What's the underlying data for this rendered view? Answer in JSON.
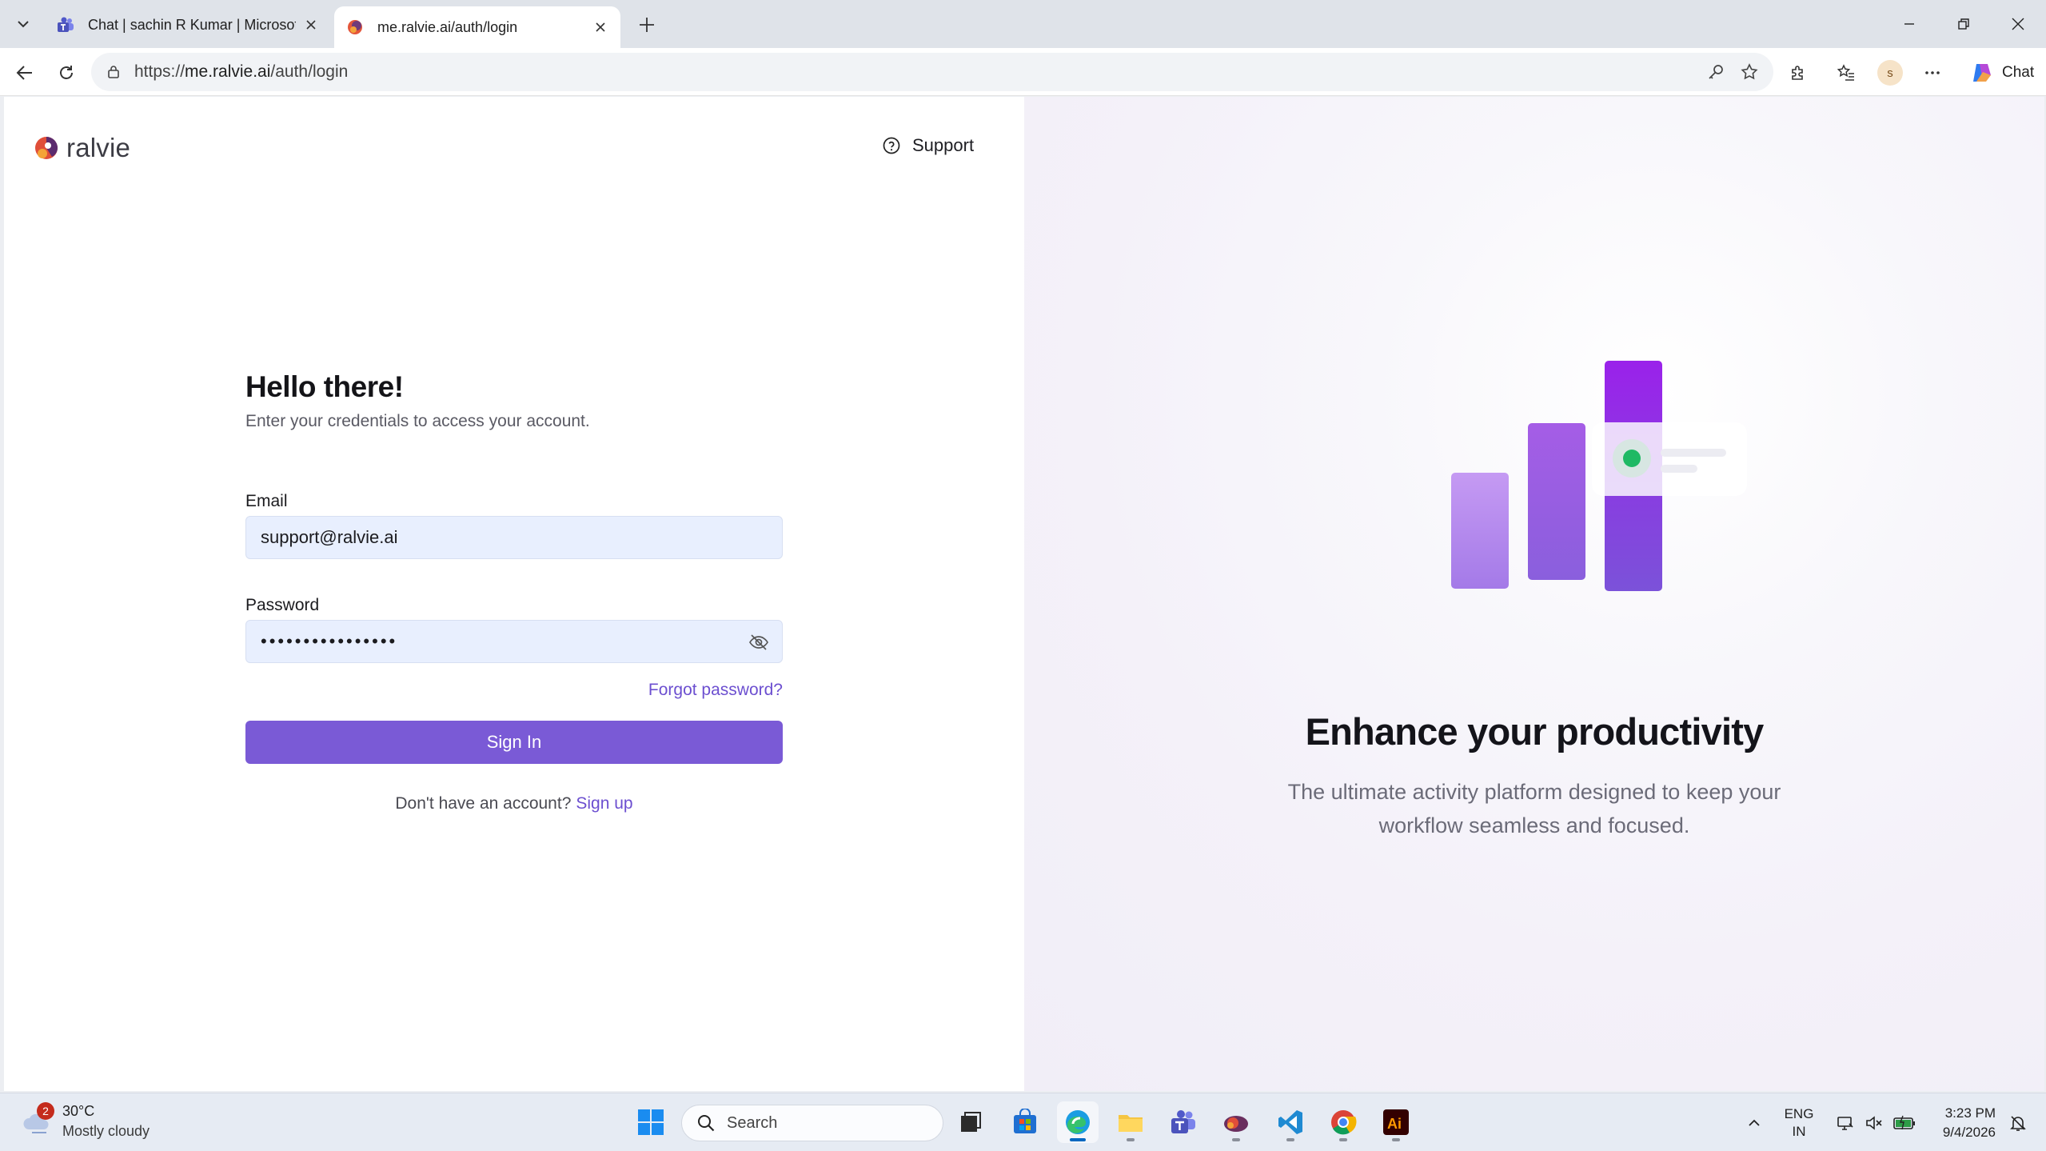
{
  "browser": {
    "tabs": [
      {
        "title": "Chat | sachin R Kumar | Microsoft Teams",
        "active": false
      },
      {
        "title": "me.ralvie.ai/auth/login",
        "active": true
      }
    ],
    "url_scheme": "https://",
    "url_host": "me.ralvie.ai",
    "url_path": "/auth/login",
    "profile_initial": "s",
    "copilot_label": "Chat"
  },
  "page": {
    "brand_name": "ralvie",
    "support_label": "Support",
    "heading": "Hello there!",
    "subtitle": "Enter your credentials to access your account.",
    "email_label": "Email",
    "email_value": "support@ralvie.ai",
    "password_label": "Password",
    "password_masked": "••••••••••••••••",
    "forgot_label": "Forgot password?",
    "signin_label": "Sign In",
    "signup_prompt": "Don't have an account?",
    "signup_label": "Sign up",
    "promo_title": "Enhance your productivity",
    "promo_subtitle": "The ultimate activity platform designed to keep your workflow seamless and focused."
  },
  "taskbar": {
    "weather_badge": "2",
    "temperature": "30°C",
    "condition": "Mostly cloudy",
    "search_placeholder": "Search",
    "lang_line1": "ENG",
    "lang_line2": "IN",
    "time": "3:23 PM",
    "date": "9/4/2026"
  },
  "colors": {
    "accent": "#7a5ad6",
    "link": "#6c4fd0",
    "input_bg": "#e8effe"
  }
}
